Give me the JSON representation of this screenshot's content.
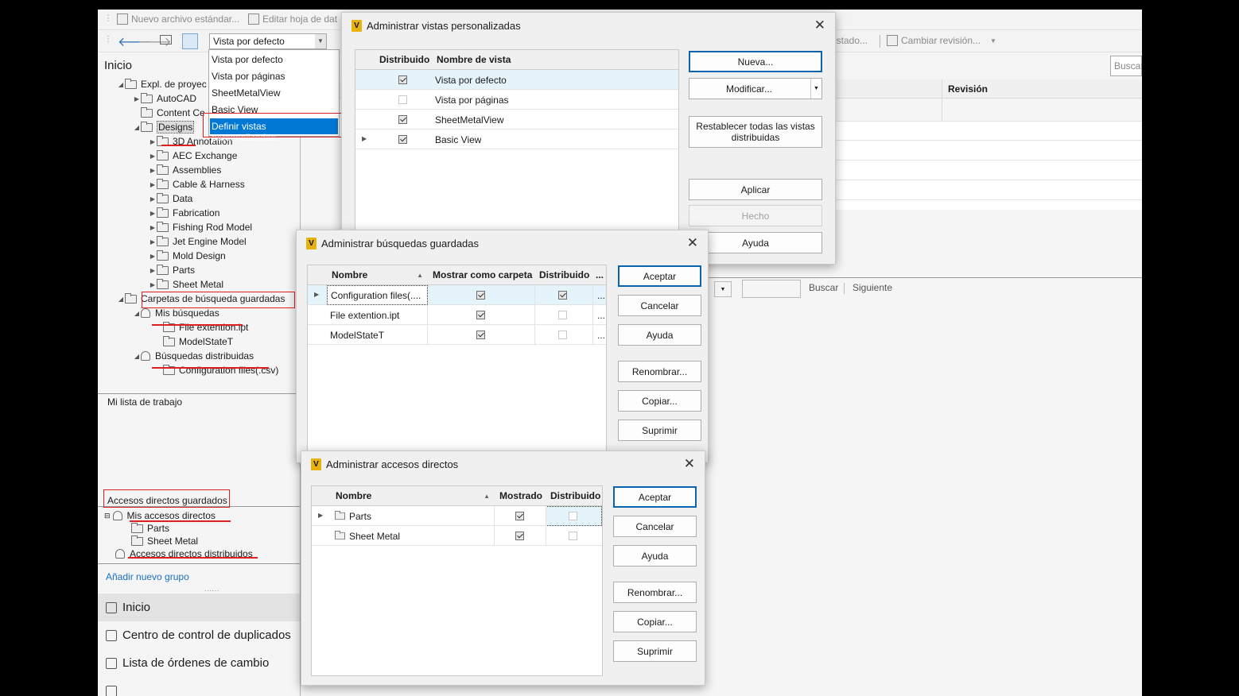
{
  "toolbar": {
    "new_standard_file": "Nuevo archivo estándar...",
    "edit_datasheet": "Editar hoja de dat",
    "view_select_value": "Vista por defecto",
    "change_state": "estado...",
    "change_revision": "Cambiar revisión...",
    "search_placeholder": "Buscar"
  },
  "view_dropdown": {
    "options": [
      "Vista por defecto",
      "Vista por páginas",
      "SheetMetalView",
      "Basic View"
    ],
    "define_custom": "Definir vistas personalizadas..."
  },
  "left_panel": {
    "home_label": "Inicio",
    "tree": {
      "project_explorer": "Expl. de proyec",
      "autocad": "AutoCAD",
      "content_center": "Content Ce",
      "designs": "Designs",
      "design_children": [
        "3D Annotation",
        "AEC Exchange",
        "Assemblies",
        "Cable & Harness",
        "Data",
        "Fabrication",
        "Fishing Rod Model",
        "Jet Engine Model",
        "Mold Design",
        "Parts",
        "Sheet Metal"
      ],
      "saved_search_folders": "Carpetas de búsqueda guardadas",
      "my_searches": "Mis búsquedas",
      "my_search_items": [
        "File extention.ipt",
        "ModelStateT"
      ],
      "distributed_searches": "Búsquedas distribuidas",
      "distributed_search_items": [
        "Configuration files(.csv)"
      ]
    },
    "worklist_title": "Mi lista de trabajo",
    "shortcuts_title": "Accesos directos guardados",
    "my_shortcuts": "Mis accesos directos",
    "my_shortcut_items": [
      "Parts",
      "Sheet Metal"
    ],
    "distributed_shortcuts": "Accesos directos distribuidos",
    "add_group": "Añadir nuevo grupo",
    "nav": [
      "Inicio",
      "Centro de control de duplicados",
      "Lista de órdenes de cambio"
    ]
  },
  "main_panel": {
    "revision_header": "Revisión",
    "search_label": "Buscar",
    "next_label": "Siguiente"
  },
  "dialog_views": {
    "title": "Administrar vistas personalizadas",
    "col_distributed": "Distribuido",
    "col_view_name": "Nombre de vista",
    "rows": [
      {
        "name": "Vista por defecto",
        "distributed": true
      },
      {
        "name": "Vista por páginas",
        "distributed": false
      },
      {
        "name": "SheetMetalView",
        "distributed": true
      },
      {
        "name": "Basic View",
        "distributed": true
      }
    ],
    "btn_new": "Nueva...",
    "btn_modify": "Modificar...",
    "btn_reset": "Restablecer todas las vistas distribuidas",
    "btn_apply": "Aplicar",
    "btn_done": "Hecho",
    "btn_help": "Ayuda"
  },
  "dialog_searches": {
    "title": "Administrar búsquedas guardadas",
    "col_name": "Nombre",
    "col_show_folder": "Mostrar como carpeta",
    "col_distributed": "Distribuido",
    "col_more": "...",
    "rows": [
      {
        "name": "Configuration files(....",
        "folder": true,
        "distributed": true,
        "more": "..."
      },
      {
        "name": "File extention.ipt",
        "folder": true,
        "distributed": false,
        "more": "..."
      },
      {
        "name": "ModelStateT",
        "folder": true,
        "distributed": false,
        "more": "..."
      }
    ],
    "btn_ok": "Aceptar",
    "btn_cancel": "Cancelar",
    "btn_help": "Ayuda",
    "btn_rename": "Renombrar...",
    "btn_copy": "Copiar...",
    "btn_delete": "Suprimir"
  },
  "dialog_shortcuts": {
    "title": "Administrar accesos directos",
    "col_name": "Nombre",
    "col_shown": "Mostrado",
    "col_distributed": "Distribuido",
    "rows": [
      {
        "name": "Parts",
        "shown": true,
        "distributed": false
      },
      {
        "name": "Sheet Metal",
        "shown": true,
        "distributed": false
      }
    ],
    "btn_ok": "Aceptar",
    "btn_cancel": "Cancelar",
    "btn_help": "Ayuda",
    "btn_rename": "Renombrar...",
    "btn_copy": "Copiar...",
    "btn_delete": "Suprimir"
  },
  "colors": {
    "accent": "#0a64ad",
    "highlight": "#0078d4",
    "annotation": "#e02020",
    "brand": "#e8b20e"
  }
}
